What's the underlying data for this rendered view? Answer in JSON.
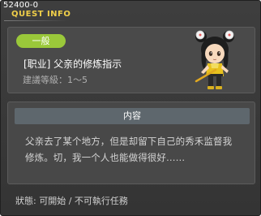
{
  "window": {
    "id_label": "52400-0",
    "title": "QUEST INFO"
  },
  "quest": {
    "category_badge": "一般",
    "name": "[职业] 父亲的修炼指示",
    "level_text": "建議等級：1～5",
    "portrait_icon": "girl-character-portrait"
  },
  "content": {
    "header": "内容",
    "line1": "父亲去了某个地方，但是却留下自己的秀禾监督我",
    "line2": "修炼。切，我一个人也能做得很好……"
  },
  "status": {
    "text": "狀態: 可開始 / 不可執行任務"
  },
  "colors": {
    "title": "#f0cf49",
    "badge": "#9ac83a",
    "header_bar": "#5e676d",
    "window_bg": "#3a3a3a"
  }
}
